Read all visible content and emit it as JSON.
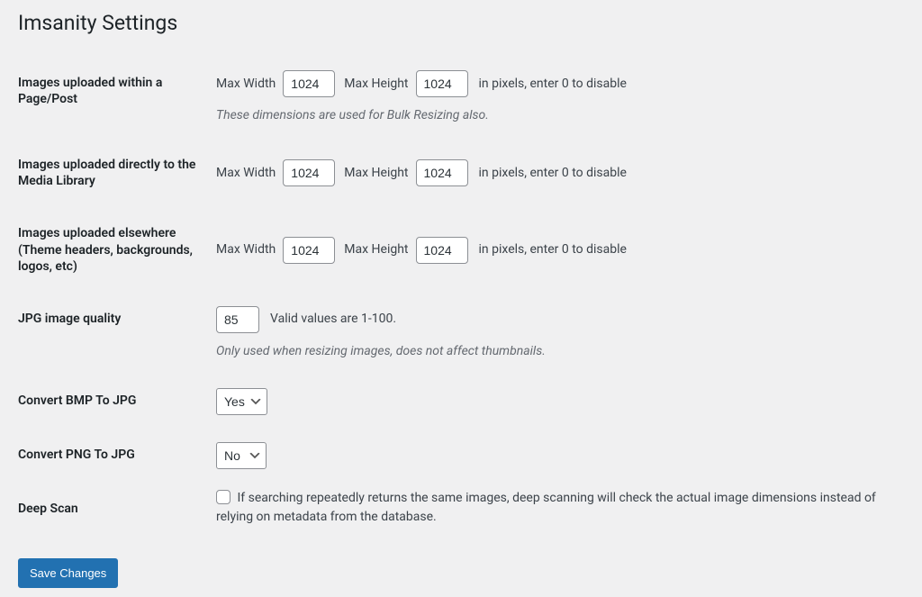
{
  "page": {
    "title": "Imsanity Settings"
  },
  "rows": {
    "pagePost": {
      "label": "Images uploaded within a Page/Post",
      "maxWidthLabel": "Max Width",
      "maxWidthValue": "1024",
      "maxHeightLabel": "Max Height",
      "maxHeightValue": "1024",
      "suffix": "in pixels, enter 0 to disable",
      "description": "These dimensions are used for Bulk Resizing also."
    },
    "mediaLibrary": {
      "label": "Images uploaded directly to the Media Library",
      "maxWidthLabel": "Max Width",
      "maxWidthValue": "1024",
      "maxHeightLabel": "Max Height",
      "maxHeightValue": "1024",
      "suffix": "in pixels, enter 0 to disable"
    },
    "elsewhere": {
      "label": "Images uploaded elsewhere (Theme headers, backgrounds, logos, etc)",
      "maxWidthLabel": "Max Width",
      "maxWidthValue": "1024",
      "maxHeightLabel": "Max Height",
      "maxHeightValue": "1024",
      "suffix": "in pixels, enter 0 to disable"
    },
    "jpgQuality": {
      "label": "JPG image quality",
      "value": "85",
      "hint": "Valid values are 1-100.",
      "description": "Only used when resizing images, does not affect thumbnails."
    },
    "bmpToJpg": {
      "label": "Convert BMP To JPG",
      "selected": "Yes"
    },
    "pngToJpg": {
      "label": "Convert PNG To JPG",
      "selected": "No"
    },
    "deepScan": {
      "label": "Deep Scan",
      "text": "If searching repeatedly returns the same images, deep scanning will check the actual image dimensions instead of relying on metadata from the database."
    }
  },
  "submit": {
    "label": "Save Changes"
  }
}
